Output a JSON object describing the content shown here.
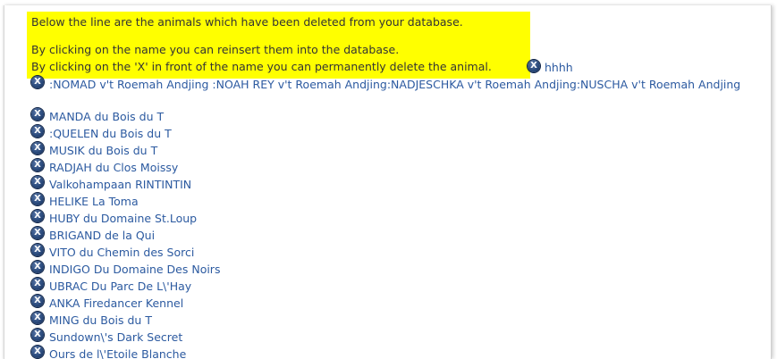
{
  "notice": {
    "line1": "Below the line are the animals which have been deleted from your database.",
    "line2": "By clicking on the name you can reinsert them into the database.",
    "line3": "By clicking on the 'X' in front of the name you can permanently delete the animal."
  },
  "first_item": "hhhh",
  "long_item": ":NOMAD v't Roemah Andjing :NOAH REY v't Roemah Andjing:NADJESCHKA v't Roemah Andjing:NUSCHA v't Roemah Andjing",
  "items": [
    "MANDA du Bois du T",
    ":QUELEN du Bois du T",
    "MUSIK du Bois du T",
    "RADJAH du Clos Moissy",
    "Valkohampaan RINTINTIN",
    "HELIKE La Toma",
    "HUBY du Domaine St.Loup",
    "BRIGAND de la Qui",
    "VITO du Chemin des Sorci",
    "INDIGO Du Domaine Des Noirs",
    "UBRAC Du Parc De L\\'Hay",
    "ANKA Firedancer Kennel",
    "MING du Bois du T",
    "Sundown\\'s Dark Secret",
    "Ours de l\\'Etoile Blanche"
  ],
  "colors": {
    "highlight": "#ffff00",
    "link": "#2c5aa0",
    "text": "#333333",
    "delete_icon": "#2a4a7c"
  },
  "icons": {
    "delete": "x-circle-icon"
  }
}
